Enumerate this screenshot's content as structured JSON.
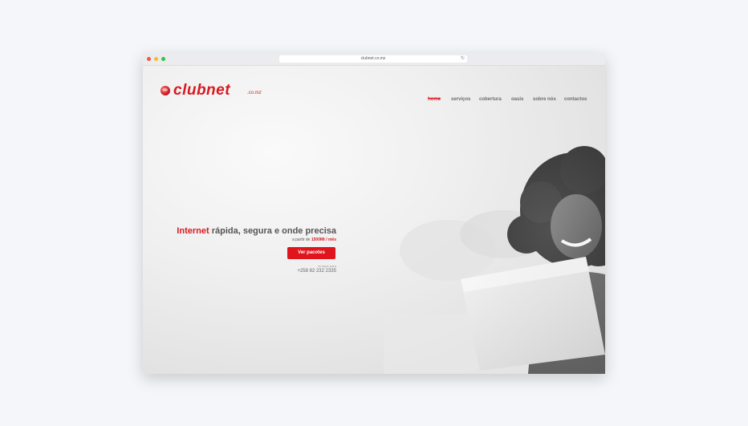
{
  "browser": {
    "url": "clubnet.co.mz"
  },
  "logo": {
    "text": "clubnet",
    "suffix": ".co.mz"
  },
  "nav": {
    "items": [
      "home",
      "serviços",
      "cobertura",
      "oasis",
      "sobre nós",
      "contactos"
    ],
    "active": "home"
  },
  "hero": {
    "headline_accent": "Internet",
    "headline_rest": "rápida, segura e onde precisa",
    "price_prefix": "a partir de",
    "price_value": "1500Mt / mês",
    "cta_label": "Ver pacotes",
    "call_label": "ou ligue para",
    "phone": "+258 82 232 2335"
  },
  "colors": {
    "brand_red": "#d7191f",
    "cta_red": "#e0141d",
    "window_chrome": "#ecebee",
    "background": "#f4f6f9"
  }
}
